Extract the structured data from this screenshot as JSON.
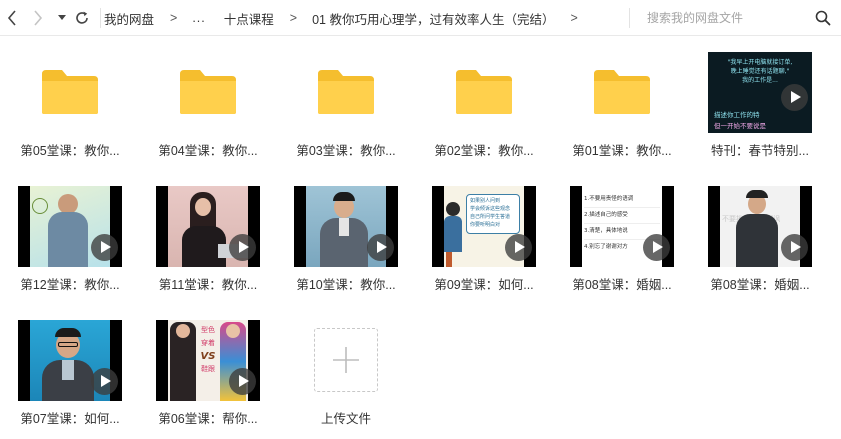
{
  "breadcrumb": [
    {
      "label": "我的网盘"
    },
    {
      "label": "..."
    },
    {
      "label": "十点课程"
    },
    {
      "label": "01 教你巧用心理学，过有效率人生（完结）"
    }
  ],
  "search": {
    "placeholder": "搜索我的网盘文件"
  },
  "items": [
    {
      "type": "folder",
      "label": "第05堂课：教你..."
    },
    {
      "type": "folder",
      "label": "第04堂课：教你..."
    },
    {
      "type": "folder",
      "label": "第03堂课：教你..."
    },
    {
      "type": "folder",
      "label": "第02堂课：教你..."
    },
    {
      "type": "folder",
      "label": "第01堂课：教你..."
    },
    {
      "type": "video",
      "label": "特刊：春节特别...",
      "thumb_lines": [
        "\"我早上开电脑就接订单,",
        "晚上睡觉还有话题聊,\"",
        "我的工作是...",
        "描述你工作的特",
        "但一开始不要说是"
      ]
    },
    {
      "type": "video",
      "label": "第12堂课：教你..."
    },
    {
      "type": "video",
      "label": "第11堂课：教你..."
    },
    {
      "type": "video",
      "label": "第10堂课：教你..."
    },
    {
      "type": "video",
      "label": "第09堂课：如何...",
      "thumb_lines": [
        "如果别人问到",
        "学会倾诉这些观念",
        "自己所问学生答道",
        "你要听明白对"
      ]
    },
    {
      "type": "video",
      "label": "第08堂课：婚姻...",
      "thumb_lines": [
        "1.不要用责怪的语调",
        "2.描述自己的感受",
        "3.清楚，具体地说",
        "4.别忘了谢谢对方"
      ]
    },
    {
      "type": "video",
      "label": "第08堂课：婚姻...",
      "thumb_lines": [
        "不要批评,不要嘲讽"
      ]
    },
    {
      "type": "video",
      "label": "第07堂课：如何..."
    },
    {
      "type": "video",
      "label": "第06堂课：帮你...",
      "thumb_lines": [
        "型色",
        "穿着",
        "VS",
        "鞋跟"
      ]
    },
    {
      "type": "upload",
      "label": "上传文件"
    }
  ],
  "colors": {
    "folder": "#FFD04C",
    "folder_tab": "#F5BE2E",
    "border": "#e9e9e9"
  }
}
